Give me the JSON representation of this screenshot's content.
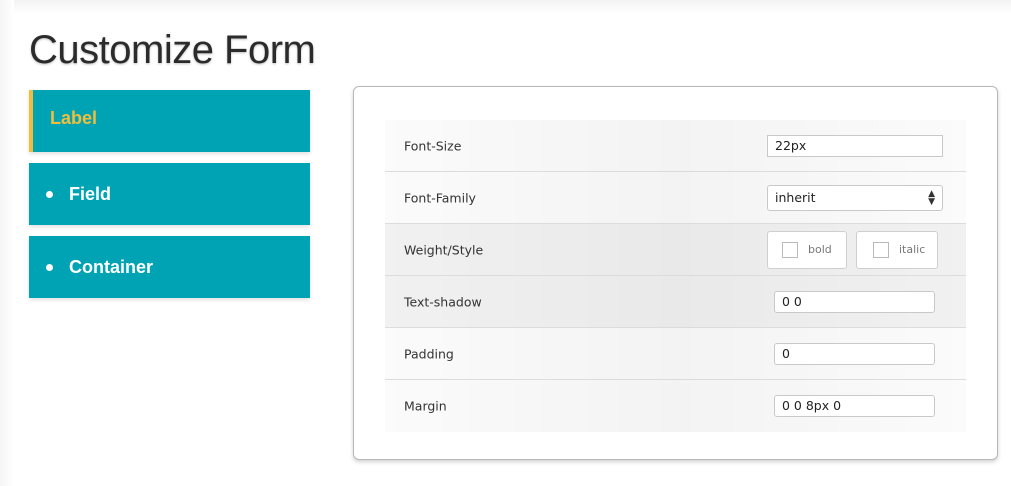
{
  "page": {
    "title": "Customize Form"
  },
  "nav": {
    "items": [
      {
        "label": "Label",
        "active": true
      },
      {
        "label": "Field",
        "active": false
      },
      {
        "label": "Container",
        "active": false
      }
    ]
  },
  "form": {
    "font_size": {
      "label": "Font-Size",
      "value": "22px"
    },
    "font_family": {
      "label": "Font-Family",
      "value": "inherit"
    },
    "weight_style": {
      "label": "Weight/Style",
      "bold_label": "bold",
      "italic_label": "italic"
    },
    "text_shadow": {
      "label": "Text-shadow",
      "value": "0 0"
    },
    "padding": {
      "label": "Padding",
      "value": "0"
    },
    "margin": {
      "label": "Margin",
      "value": "0 0 8px 0"
    }
  },
  "colors": {
    "nav_bg": "#00a3b4",
    "active_accent": "#f0be3c"
  }
}
